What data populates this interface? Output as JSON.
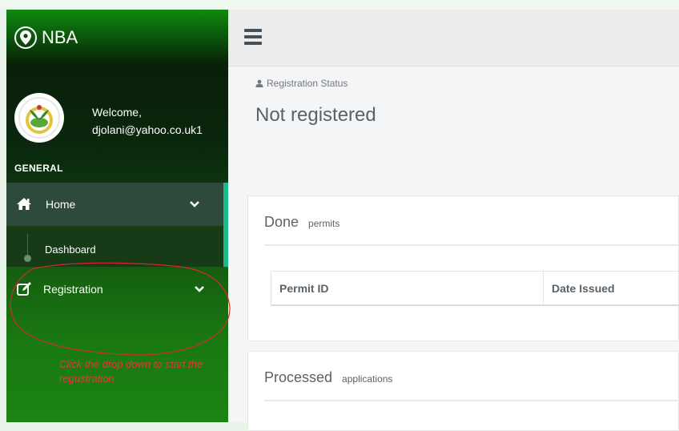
{
  "brand": {
    "title": "NBA"
  },
  "profile": {
    "welcome": "Welcome,",
    "username": "djolani@yahoo.co.uk1"
  },
  "sidebar": {
    "section_label": "GENERAL",
    "items": [
      {
        "label": "Home"
      },
      {
        "label": "Dashboard"
      },
      {
        "label": "Registration"
      }
    ]
  },
  "main": {
    "status_label": "Registration Status",
    "status_value": "Not registered",
    "panels": [
      {
        "title": "Done",
        "subtitle": "permits",
        "columns": [
          "Permit ID",
          "Date Issued"
        ]
      },
      {
        "title": "Processed",
        "subtitle": "applications"
      }
    ]
  },
  "annotation": {
    "note": "Click the drop down to start the regustration"
  },
  "colors": {
    "accent": "#1aba8a",
    "annotation": "#e03a3a",
    "sidebar": "#0d3a10"
  },
  "icons": [
    "map-marker-icon",
    "home-icon",
    "edit-icon",
    "chevron-down-icon",
    "user-icon",
    "hamburger-icon"
  ]
}
